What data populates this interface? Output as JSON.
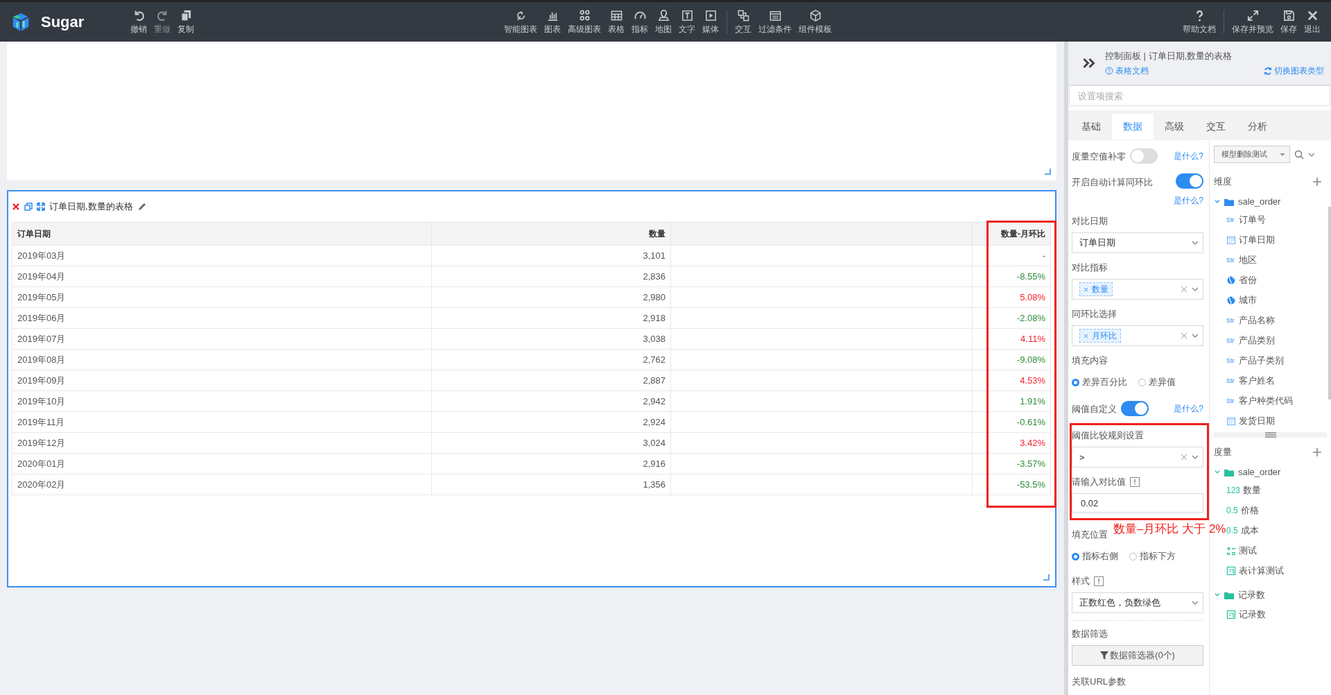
{
  "toolbar": {
    "logo": "Sugar",
    "left": [
      {
        "label": "撤销",
        "disabled": false
      },
      {
        "label": "重做",
        "disabled": true
      },
      {
        "label": "复制",
        "disabled": false
      }
    ],
    "center": [
      [
        {
          "label": "智能图表"
        },
        {
          "label": "图表"
        },
        {
          "label": "高级图表"
        },
        {
          "label": "表格"
        },
        {
          "label": "指标"
        },
        {
          "label": "地图"
        },
        {
          "label": "文字"
        },
        {
          "label": "媒体"
        }
      ],
      [
        {
          "label": "交互"
        },
        {
          "label": "过滤条件"
        },
        {
          "label": "组件模板"
        }
      ]
    ],
    "right": [
      [
        {
          "label": "帮助文档"
        }
      ],
      [
        {
          "label": "保存并预览"
        },
        {
          "label": "保存"
        },
        {
          "label": "退出"
        }
      ]
    ]
  },
  "table_card": {
    "title": "订单日期,数量的表格",
    "columns": [
      {
        "label": "订单日期"
      },
      {
        "label": "数量"
      },
      {
        "label": "数量-月环比"
      }
    ],
    "rows": [
      {
        "date": "2019年03月",
        "quantity": "3,101",
        "change": "-"
      },
      {
        "date": "2019年04月",
        "quantity": "2,836",
        "change": "-8.55%",
        "color": "#2e8b3a"
      },
      {
        "date": "2019年05月",
        "quantity": "2,980",
        "change": "5.08%",
        "color": "#f5222d"
      },
      {
        "date": "2019年06月",
        "quantity": "2,918",
        "change": "-2.08%",
        "color": "#2e8b3a"
      },
      {
        "date": "2019年07月",
        "quantity": "3,038",
        "change": "4.11%",
        "color": "#f5222d"
      },
      {
        "date": "2019年08月",
        "quantity": "2,762",
        "change": "-9.08%",
        "color": "#2e8b3a"
      },
      {
        "date": "2019年09月",
        "quantity": "2,887",
        "change": "4.53%",
        "color": "#f5222d"
      },
      {
        "date": "2019年10月",
        "quantity": "2,942",
        "change": "1.91%",
        "color": "#2e8b3a"
      },
      {
        "date": "2019年11月",
        "quantity": "2,924",
        "change": "-0.61%",
        "color": "#2e8b3a"
      },
      {
        "date": "2019年12月",
        "quantity": "3,024",
        "change": "3.42%",
        "color": "#f5222d"
      },
      {
        "date": "2020年01月",
        "quantity": "2,916",
        "change": "-3.57%",
        "color": "#2e8b3a"
      },
      {
        "date": "2020年02月",
        "quantity": "1,356",
        "change": "-53.5%",
        "color": "#2e8b3a"
      }
    ]
  },
  "panel": {
    "title": "控制面板 | 订单日期,数量的表格",
    "doc_link": "表格文档",
    "switch_link": "切换图表类型",
    "search": {
      "placeholder": "设置项搜索"
    },
    "tabs": [
      {
        "label": "基础",
        "selected": false
      },
      {
        "label": "数据",
        "selected": true
      },
      {
        "label": "高级",
        "selected": false
      },
      {
        "label": "交互",
        "selected": false
      },
      {
        "label": "分析",
        "selected": false
      }
    ],
    "settings": [
      {
        "kind": "toggle",
        "label": "度量空值补零",
        "on": false,
        "help": "是什么?"
      },
      {
        "kind": "toggle",
        "label": "开启自动计算同环比",
        "on": true,
        "help": "是什么?"
      },
      {
        "kind": "select",
        "label": "对比日期",
        "value": "订单日期",
        "clearable": false
      },
      {
        "kind": "tags",
        "label": "对比指标",
        "tags": [
          "数量"
        ]
      },
      {
        "kind": "tags",
        "label": "同环比选择",
        "tags": [
          "月环比"
        ]
      },
      {
        "kind": "radio",
        "label": "填充内容",
        "options": [
          {
            "label": "差异百分比",
            "selected": true
          },
          {
            "label": "差异值",
            "selected": false
          }
        ]
      },
      {
        "kind": "toggle",
        "label": "阈值自定义",
        "on": true,
        "help": "是什么?"
      },
      {
        "kind": "select",
        "label": "阈值比较规则设置",
        "value": ">",
        "clearable": true
      },
      {
        "kind": "input",
        "label": "请输入对比值",
        "info": true,
        "value": "0.02"
      },
      {
        "kind": "radio",
        "label": "填充位置",
        "options": [
          {
            "label": "指标右侧",
            "selected": true
          },
          {
            "label": "指标下方",
            "selected": false
          }
        ]
      },
      {
        "kind": "select",
        "label": "样式",
        "info": true,
        "value": "正数红色，负数绿色",
        "clearable": false
      },
      {
        "kind": "button",
        "label": "数据筛选",
        "value": "数据筛选器(0个)"
      },
      {
        "kind": "heading",
        "label": "关联URL参数"
      }
    ],
    "fields": {
      "dataset": "模型删除测试",
      "groups": [
        {
          "title": "维度",
          "folders": [
            {
              "name": "sale_order",
              "expanded": true,
              "items": [
                {
                  "name": "订单号",
                  "kind": "text",
                  "tag": "Str"
                },
                {
                  "name": "订单日期",
                  "kind": "date"
                },
                {
                  "name": "地区",
                  "kind": "text",
                  "tag": "Str"
                },
                {
                  "name": "省份",
                  "kind": "geo"
                },
                {
                  "name": "城市",
                  "kind": "geo"
                },
                {
                  "name": "产品名称",
                  "kind": "text",
                  "tag": "Str"
                },
                {
                  "name": "产品类别",
                  "kind": "text",
                  "tag": "Str"
                },
                {
                  "name": "产品子类别",
                  "kind": "text",
                  "tag": "Str"
                },
                {
                  "name": "客户姓名",
                  "kind": "text",
                  "tag": "Str"
                },
                {
                  "name": "客户种类代码",
                  "kind": "text",
                  "tag": "Str"
                },
                {
                  "name": "发货日期",
                  "kind": "date"
                }
              ]
            }
          ]
        },
        {
          "title": "度量",
          "folders": [
            {
              "name": "sale_order",
              "expanded": true,
              "items": [
                {
                  "name": "数量",
                  "kind": "number",
                  "tag": "123"
                },
                {
                  "name": "价格",
                  "kind": "number",
                  "tag": "0.5"
                },
                {
                  "name": "成本",
                  "kind": "number",
                  "tag": "0.5"
                },
                {
                  "name": "测试",
                  "kind": "calc"
                },
                {
                  "name": "表计算测试",
                  "kind": "table"
                }
              ]
            },
            {
              "name": "记录数",
              "expanded": true,
              "items": [
                {
                  "name": "记录数",
                  "kind": "table"
                }
              ]
            }
          ]
        }
      ]
    }
  },
  "annotation": {
    "text": "数量–月环比 大于 2%"
  }
}
